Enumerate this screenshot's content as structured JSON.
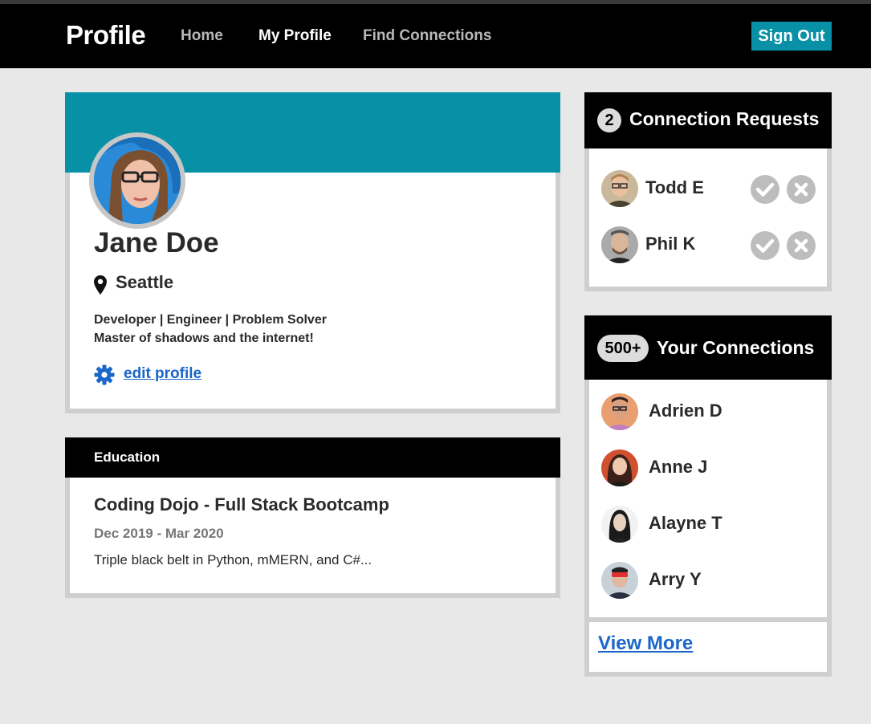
{
  "nav": {
    "brand": "Profile",
    "links": [
      "Home",
      "My Profile",
      "Find Connections"
    ],
    "sign_out": "Sign Out"
  },
  "profile": {
    "name": "Jane Doe",
    "location": "Seattle",
    "bio_line1": "Developer | Engineer | Problem Solver",
    "bio_line2": "Master of shadows and the internet!",
    "edit_label": "edit profile"
  },
  "education": {
    "header": "Education",
    "school": "Coding Dojo - Full Stack Bootcamp",
    "dates": "Dec 2019 - Mar 2020",
    "description": "Triple black belt in Python, mMERN, and C#..."
  },
  "requests": {
    "count": "2",
    "title": "Connection Requests",
    "people": [
      {
        "name": "Todd E"
      },
      {
        "name": "Phil K"
      }
    ]
  },
  "connections": {
    "count": "500+",
    "title": "Your Connections",
    "people": [
      {
        "name": "Adrien D"
      },
      {
        "name": "Anne J"
      },
      {
        "name": "Alayne T"
      },
      {
        "name": "Arry Y"
      }
    ],
    "view_more": "View More"
  },
  "colors": {
    "accent": "#0891a6",
    "link": "#1a66c9",
    "navbar": "#000000",
    "background": "#e8e8e8"
  }
}
